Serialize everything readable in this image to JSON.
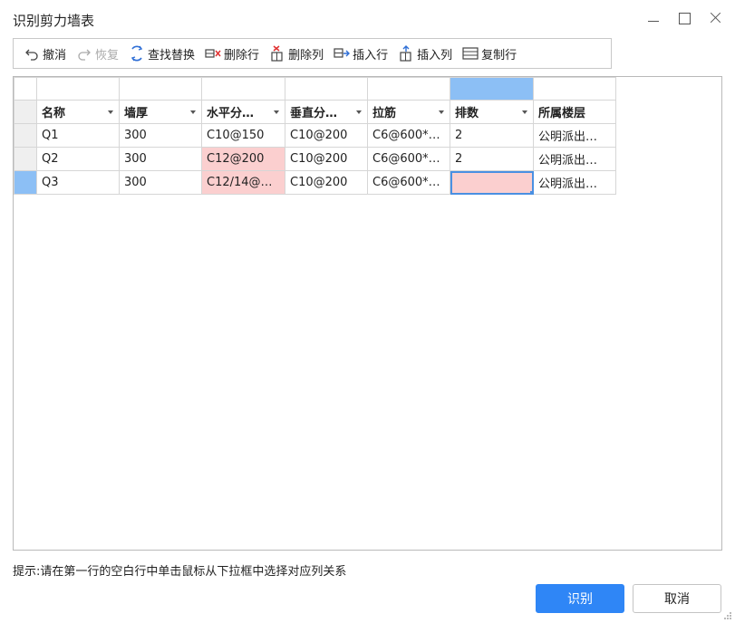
{
  "window": {
    "title": "识别剪力墙表"
  },
  "toolbar": {
    "undo": "撤消",
    "redo": "恢复",
    "find_replace": "查找替换",
    "delete_row": "删除行",
    "delete_col": "删除列",
    "insert_row": "插入行",
    "insert_col": "插入列",
    "copy_row": "复制行"
  },
  "table": {
    "headers": [
      "名称",
      "墙厚",
      "水平分…",
      "垂直分…",
      "拉筋",
      "排数",
      "所属楼层"
    ],
    "rows": [
      [
        "Q1",
        "300",
        "C10@150",
        "C10@200",
        "C6@600*…",
        "2",
        "公明派出…"
      ],
      [
        "Q2",
        "300",
        "C12@200",
        "C10@200",
        "C6@600*…",
        "2",
        "公明派出…"
      ],
      [
        "Q3",
        "300",
        "C12/14@…",
        "C10@200",
        "C6@600*…",
        "",
        "公明派出…"
      ]
    ]
  },
  "hint": "提示:请在第一行的空白行中单击鼠标从下拉框中选择对应列关系",
  "buttons": {
    "recognize": "识别",
    "cancel": "取消"
  },
  "colors": {
    "accent": "#2f86f6",
    "selection": "#8cbff5",
    "error_cell": "#fbcfcf"
  }
}
